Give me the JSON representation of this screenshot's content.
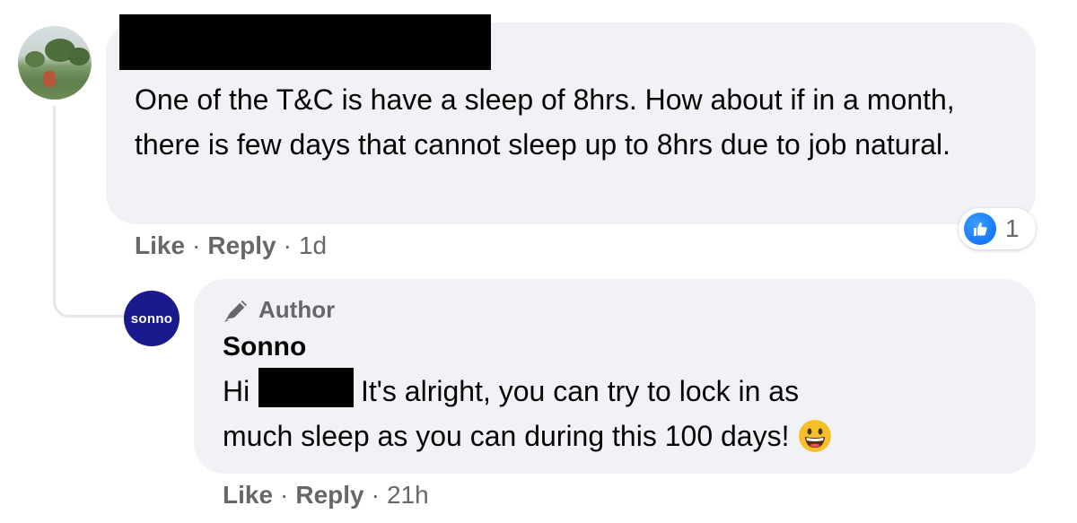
{
  "comment": {
    "text": "One of the T&C is have a sleep of 8hrs. How about if in a month, there is few days that cannot sleep up to 8hrs due to job natural.",
    "actions": {
      "like": "Like",
      "reply": "Reply",
      "time": "1d"
    },
    "reaction": {
      "icon": "thumbs-up-icon",
      "count": "1"
    }
  },
  "reply": {
    "avatar_text": "sonno",
    "badge": "Author",
    "author": "Sonno",
    "line1_prefix": "Hi",
    "line1_rest": "! It's alright, you can try to lock in as",
    "line2": "much sleep as you can during this 100 days!",
    "emoji": "grinning-face-emoji",
    "actions": {
      "like": "Like",
      "reply": "Reply",
      "time": "21h"
    }
  },
  "colors": {
    "bubble": "#f0f2f5",
    "meta": "#65676b",
    "like_blue": "#0866ff",
    "sonno_brand": "#1a1a8f"
  }
}
